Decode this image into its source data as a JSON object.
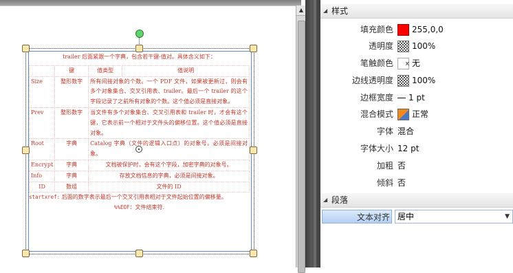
{
  "document": {
    "intro": "trailer 后面紧跟一个字典，包含若干键-值对。具体含义如下：",
    "headers": [
      "键",
      "值类型",
      "值说明"
    ],
    "rows": [
      {
        "key": "Size",
        "type": "整形数字",
        "desc": "所有间接对象的个数。一个 PDF 文件，如果被更新过，则会有多个对象集合、交叉引用表、trailer。最后一个 trailer 的这个字段记录了之前所有对象的个数。这个值必须是直接对象。"
      },
      {
        "key": "Prev",
        "type": "整形数字",
        "desc": "当文件有多个对象集合、交叉引用表和 trailer 时，才会有这个键，它表示前一个相对于文件头的偏移位置。这个值必须是直接对象。"
      },
      {
        "key": "Root",
        "type": "字典",
        "desc": "Catalog 字典（文件的逻辑入口点）的对象号。必须是间接对象。"
      },
      {
        "key": "Encrypt",
        "type": "字典",
        "desc": "文档被保护时，会有这个字段，加密字典的对象号。"
      },
      {
        "key": "Info",
        "type": "字典",
        "desc": "存放文档信息的字典，必须是间接对象。"
      },
      {
        "key": "ID",
        "type": "数组",
        "desc": "文件的 ID"
      }
    ],
    "startxref_label": "startxref:",
    "startxref_text": "后面的数字表示最后一个交叉引用表相对于文件起始位置的偏移量。",
    "eof_label": "%%EOF",
    "eof_text": "：文件结束符."
  },
  "panel": {
    "style_section": "样式",
    "paragraph_section": "段落",
    "properties": [
      {
        "label": "填充颜色",
        "value": "255,0,0",
        "swatch": "red"
      },
      {
        "label": "透明度",
        "value": "100%",
        "swatch": "check"
      },
      {
        "label": "笔触颜色",
        "value": "无",
        "swatch": "none"
      },
      {
        "label": "边线透明度",
        "value": "100%",
        "swatch": "check"
      },
      {
        "label": "边框宽度",
        "value": "1 pt",
        "swatch": "dash"
      },
      {
        "label": "混合模式",
        "value": "正常",
        "swatch": "blend"
      },
      {
        "label": "字体",
        "value": "混合"
      },
      {
        "label": "字体大小",
        "value": "12 pt"
      },
      {
        "label": "加粗",
        "value": "否"
      },
      {
        "label": "倾斜",
        "value": "否"
      }
    ],
    "text_align": {
      "label": "文本对齐",
      "value": "居中"
    }
  },
  "colors": {
    "fill": "#ff0000",
    "doc_text": "#c0392b",
    "selection": "#5a8ad0"
  }
}
